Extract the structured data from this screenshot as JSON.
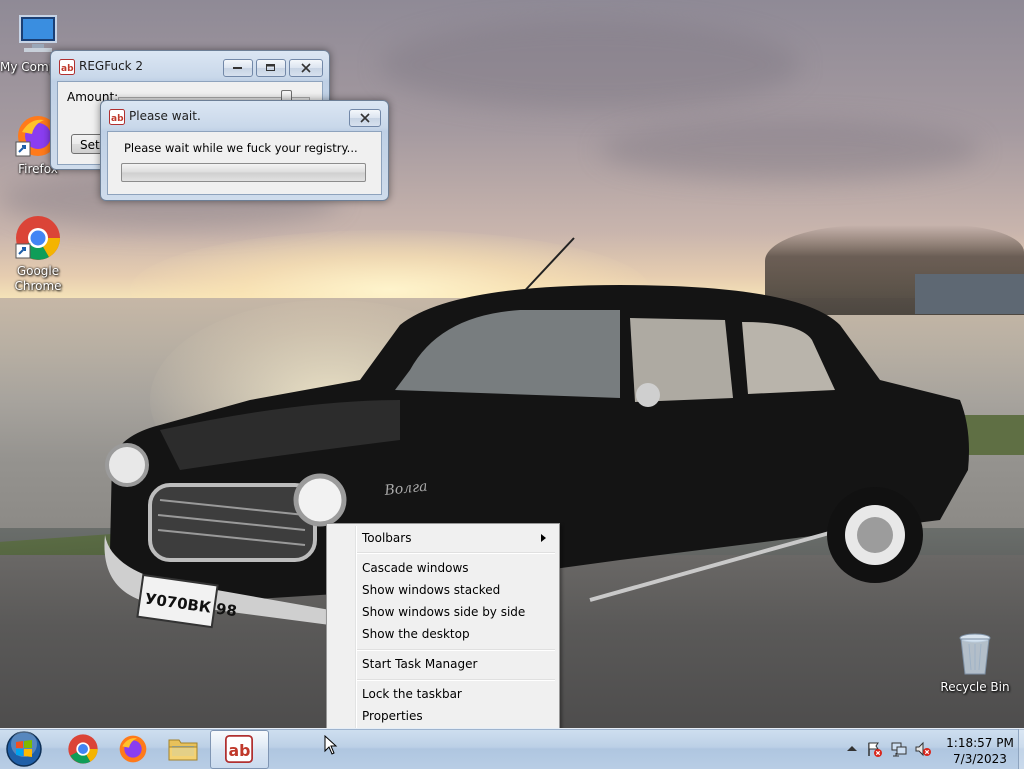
{
  "desktop": {
    "icons": [
      {
        "label": "My Computer"
      },
      {
        "label": "Firefox"
      },
      {
        "label": "Google Chrome"
      },
      {
        "label": "Recycle Bin"
      }
    ]
  },
  "regfuck_window": {
    "title": "REGFuck 2",
    "amount_label": "Amount:",
    "slider_level_fraction": 0.9,
    "button_label": "Sett"
  },
  "wait_dialog": {
    "title": "Please wait.",
    "message": "Please wait while we fuck your registry...",
    "progress_fraction": 0.0
  },
  "context_menu": {
    "items": [
      {
        "label": "Toolbars",
        "has_submenu": true
      },
      {
        "label": "Cascade windows"
      },
      {
        "label": "Show windows stacked"
      },
      {
        "label": "Show windows side by side"
      },
      {
        "label": "Show the desktop"
      },
      {
        "label": "Start Task Manager"
      },
      {
        "label": "Lock the taskbar"
      },
      {
        "label": "Properties"
      }
    ]
  },
  "taskbar": {
    "buttons": [
      {
        "icon": "start-orb-icon"
      },
      {
        "icon": "chrome-icon"
      },
      {
        "icon": "firefox-icon"
      },
      {
        "icon": "folder-icon"
      },
      {
        "icon": "regfuck-app-icon",
        "active": true
      }
    ],
    "clock": {
      "time": "1:18:57 PM",
      "date": "7/3/2023"
    },
    "tray_icons": [
      "show-hidden-icons-chevron",
      "action-center-flag-icon",
      "network-icon",
      "volume-muted-icon"
    ]
  },
  "car": {
    "plate": "У070ВК 98",
    "badge": "Волга"
  },
  "colors": {
    "accent": "#1f5fa8",
    "titlebar": "#c9d8ea"
  }
}
